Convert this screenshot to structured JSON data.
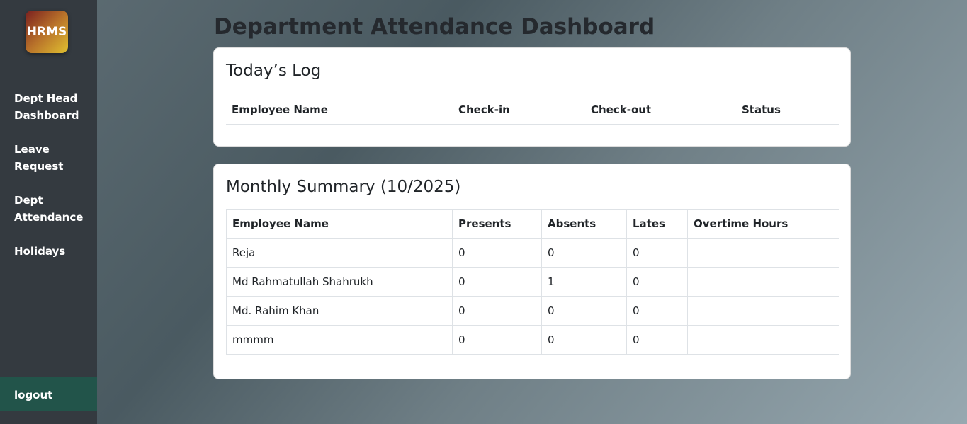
{
  "sidebar": {
    "logo": "HRMS",
    "items": [
      {
        "label": "Dept Head\nDashboard"
      },
      {
        "label": "Leave\nRequest"
      },
      {
        "label": "Dept\nAttendance"
      },
      {
        "label": "Holidays"
      }
    ],
    "logout": "logout"
  },
  "page": {
    "title": "Department Attendance Dashboard"
  },
  "today_log": {
    "title": "Today’s Log",
    "columns": [
      "Employee Name",
      "Check-in",
      "Check-out",
      "Status"
    ]
  },
  "monthly": {
    "title": "Monthly Summary (10/2025)",
    "columns": [
      "Employee Name",
      "Presents",
      "Absents",
      "Lates",
      "Overtime Hours"
    ],
    "rows": [
      {
        "name": "Reja",
        "presents": "0",
        "absents": "0",
        "lates": "0",
        "overtime": ""
      },
      {
        "name": "Md Rahmatullah Shahrukh",
        "presents": "0",
        "absents": "1",
        "lates": "0",
        "overtime": ""
      },
      {
        "name": "Md. Rahim Khan",
        "presents": "0",
        "absents": "0",
        "lates": "0",
        "overtime": ""
      },
      {
        "name": "mmmm",
        "presents": "0",
        "absents": "0",
        "lates": "0",
        "overtime": ""
      }
    ]
  }
}
